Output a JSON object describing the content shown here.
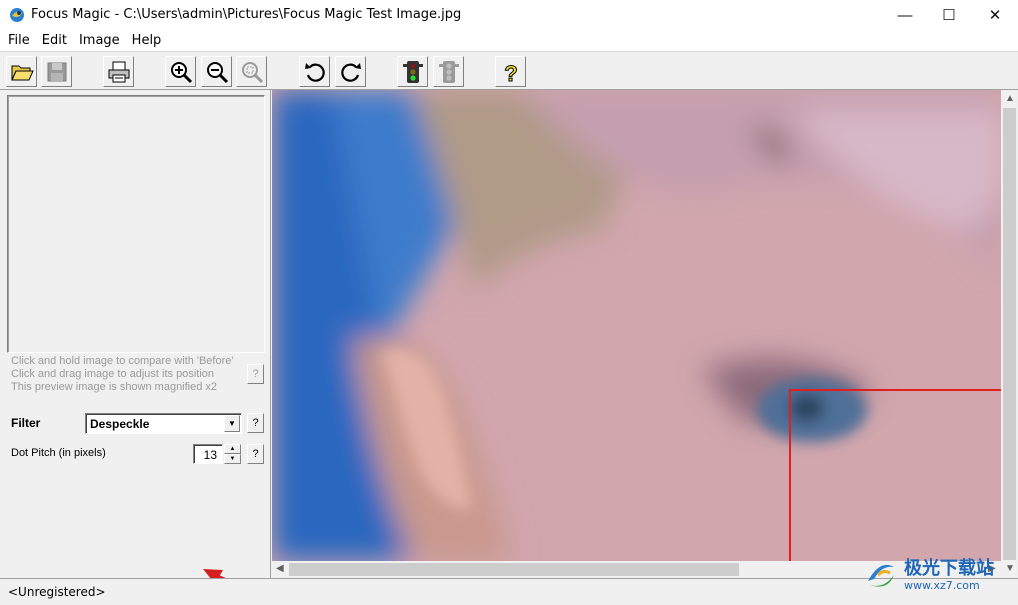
{
  "window": {
    "title": "Focus Magic - C:\\Users\\admin\\Pictures\\Focus Magic Test Image.jpg",
    "min_glyph": "—",
    "max_glyph": "☐",
    "close_glyph": "✕"
  },
  "menu": {
    "file": "File",
    "edit": "Edit",
    "image": "Image",
    "help": "Help"
  },
  "toolbar": {
    "buttons": [
      {
        "name": "open",
        "icon": "folder-open-icon"
      },
      {
        "name": "save",
        "icon": "floppy-disk-icon",
        "enabled": false
      },
      {
        "name": "print",
        "icon": "printer-icon"
      },
      {
        "name": "zoom-in",
        "icon": "zoom-in-icon"
      },
      {
        "name": "zoom-out",
        "icon": "zoom-out-icon"
      },
      {
        "name": "zoom-fit",
        "icon": "zoom-fit-icon",
        "enabled": false
      },
      {
        "name": "rotate-left",
        "icon": "rotate-left-icon"
      },
      {
        "name": "rotate-right",
        "icon": "rotate-right-icon"
      },
      {
        "name": "process",
        "icon": "traffic-light-icon"
      },
      {
        "name": "stop",
        "icon": "traffic-light-disabled-icon",
        "enabled": false
      },
      {
        "name": "help",
        "icon": "question-icon"
      }
    ],
    "help_glyph": "?"
  },
  "preview": {
    "hint_line1": "Click and hold image to compare with 'Before'",
    "hint_line2": "Click and drag image to adjust its position",
    "hint_line3": "This preview image is shown magnified x2",
    "help_label": "?"
  },
  "controls": {
    "filter_label": "Filter",
    "filter_value": "Despeckle",
    "filter_help": "?",
    "dot_pitch_label": "Dot Pitch (in pixels)",
    "dot_pitch_value": "13",
    "dot_pitch_help": "?",
    "spin_up": "▲",
    "spin_down": "▼",
    "drop_glyph": "▼"
  },
  "scroll": {
    "up": "▲",
    "down": "▼",
    "left": "◀",
    "right": "▶"
  },
  "status": {
    "text": "<Unregistered>"
  },
  "watermark": {
    "brand": "极光下载站",
    "url": "www.xz7.com"
  },
  "colors": {
    "selection_rect": "#e02020",
    "annotation_arrow": "#d42020"
  }
}
